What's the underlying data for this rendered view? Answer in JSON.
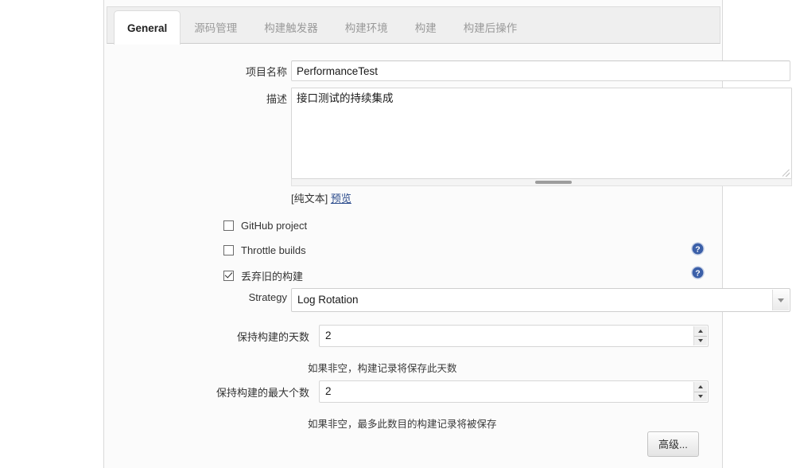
{
  "tabs": [
    {
      "label": "General",
      "active": true
    },
    {
      "label": "源码管理",
      "active": false
    },
    {
      "label": "构建触发器",
      "active": false
    },
    {
      "label": "构建环境",
      "active": false
    },
    {
      "label": "构建",
      "active": false
    },
    {
      "label": "构建后操作",
      "active": false
    }
  ],
  "form": {
    "project_name": {
      "label": "项目名称",
      "value": "PerformanceTest",
      "placeholder": ""
    },
    "description": {
      "label": "描述",
      "value": "接口测试的持续集成",
      "placeholder": "",
      "plain_text_label": "[纯文本]",
      "preview_link": "预览"
    },
    "checkboxes": [
      {
        "label": "GitHub project",
        "checked": false,
        "has_help": false
      },
      {
        "label": "Throttle builds",
        "checked": false,
        "has_help": true
      },
      {
        "label": "丢弃旧的构建",
        "checked": true,
        "has_help": true
      }
    ],
    "strategy": {
      "label": "Strategy",
      "value": "Log Rotation",
      "options": [
        "Log Rotation"
      ]
    },
    "days_to_keep": {
      "label": "保持构建的天数",
      "value": "2",
      "hint": "如果非空，构建记录将保存此天数"
    },
    "num_to_keep": {
      "label": "保持构建的最大个数",
      "value": "2",
      "hint": "如果非空，最多此数目的构建记录将被保存"
    },
    "advanced_button": "高级..."
  },
  "icons": {
    "help": "help-icon",
    "chevron_down": "chevron-down-icon",
    "spinner_up": "spinner-up-icon",
    "spinner_down": "spinner-down-icon",
    "resize_grip": "resize-grip-icon"
  },
  "colors": {
    "help_blue": "#3b5fa8",
    "link_blue": "#2b4b8c",
    "panel_bg": "#fbfbfb",
    "tabbar_bg": "#efefef"
  }
}
